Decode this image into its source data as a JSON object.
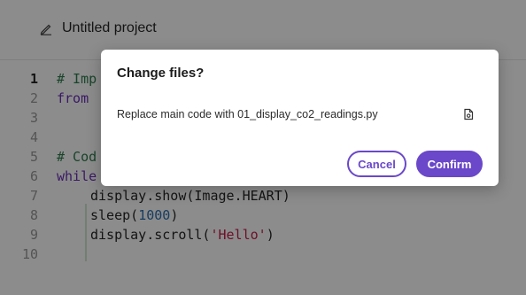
{
  "header": {
    "project_title": "Untitled project",
    "edit_icon": "pencil-icon"
  },
  "editor": {
    "line_numbers": [
      "1",
      "2",
      "3",
      "4",
      "5",
      "6",
      "7",
      "8",
      "9",
      "10"
    ],
    "active_line": "1",
    "lines": [
      [
        {
          "t": "# Imp",
          "c": "comment"
        }
      ],
      [
        {
          "t": "from",
          "c": "kw"
        }
      ],
      [],
      [],
      [
        {
          "t": "# Cod",
          "c": "comment"
        }
      ],
      [
        {
          "t": "while",
          "c": "kw"
        }
      ],
      [
        {
          "t": "display.show(Image.HEART)",
          "c": ""
        }
      ],
      [
        {
          "t": "sleep(",
          "c": ""
        },
        {
          "t": "1000",
          "c": "num"
        },
        {
          "t": ")",
          "c": ""
        }
      ],
      [
        {
          "t": "display.scroll(",
          "c": ""
        },
        {
          "t": "'Hello'",
          "c": "str"
        },
        {
          "t": ")",
          "c": ""
        }
      ],
      []
    ],
    "indented_lines": [
      6,
      7,
      8
    ]
  },
  "dialog": {
    "title": "Change files?",
    "message": "Replace main code with 01_display_co2_readings.py",
    "file_icon": "file-icon",
    "cancel_label": "Cancel",
    "confirm_label": "Confirm"
  },
  "colors": {
    "accent": "#6a48c9",
    "comment": "#2f7d4e",
    "keyword": "#6a2fb8",
    "number": "#2a6fb0",
    "string": "#c61e4a",
    "overlay": "rgba(0,0,0,0.45)"
  }
}
